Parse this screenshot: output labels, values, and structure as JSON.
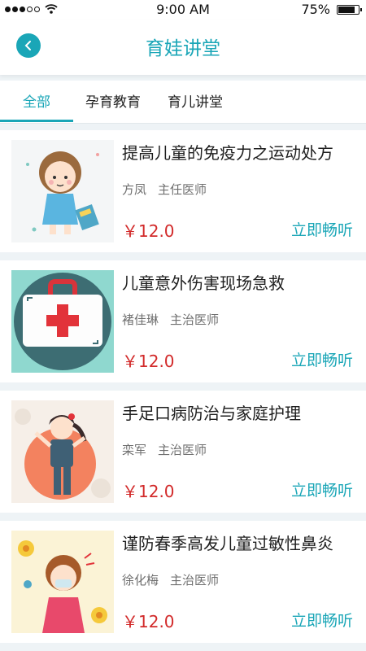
{
  "status_bar": {
    "time": "9:00 AM",
    "battery": "75%"
  },
  "header": {
    "title": "育娃讲堂"
  },
  "tabs": [
    {
      "label": "全部",
      "active": true
    },
    {
      "label": "孕育教育",
      "active": false
    },
    {
      "label": "育儿讲堂",
      "active": false
    }
  ],
  "courses": [
    {
      "title": "提高儿童的免疫力之运动处方",
      "doctor": "方凤",
      "role": "主任医师",
      "price": "￥12.0",
      "action": "立即畅听"
    },
    {
      "title": "儿童意外伤害现场急救",
      "doctor": "褚佳琳",
      "role": "主治医师",
      "price": "￥12.0",
      "action": "立即畅听"
    },
    {
      "title": "手足口病防治与家庭护理",
      "doctor": "栾军",
      "role": "主治医师",
      "price": "￥12.0",
      "action": "立即畅听"
    },
    {
      "title": "谨防春季高发儿童过敏性鼻炎",
      "doctor": "徐化梅",
      "role": "主治医师",
      "price": "￥12.0",
      "action": "立即畅听"
    }
  ],
  "colors": {
    "accent": "#1aa6b7",
    "price": "#d22a2a"
  }
}
